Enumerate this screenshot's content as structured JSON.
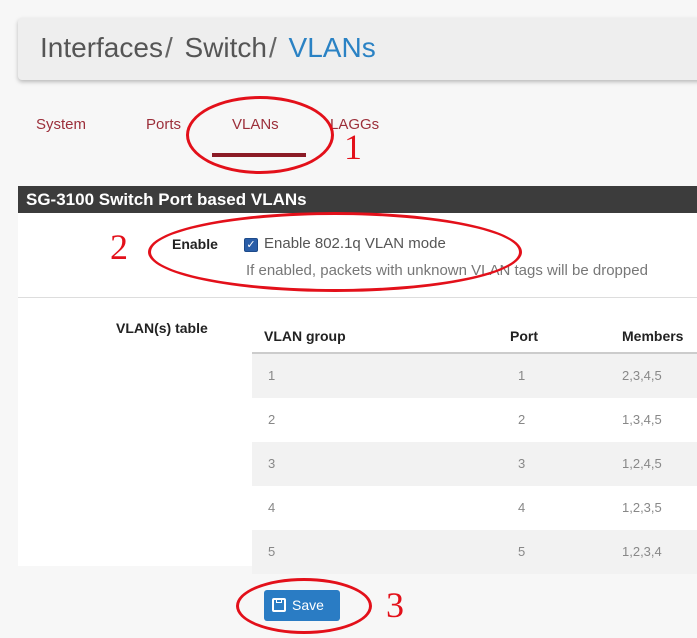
{
  "breadcrumb": {
    "items": [
      "Interfaces",
      "Switch",
      "VLANs"
    ],
    "separator": "/"
  },
  "tabs": [
    {
      "label": "System"
    },
    {
      "label": "Ports"
    },
    {
      "label": "VLANs",
      "active": true
    },
    {
      "label": "LAGGs"
    }
  ],
  "panel": {
    "title": "SG-3100 Switch Port based VLANs",
    "enable_label": "Enable",
    "enable_checkbox_label": "Enable 802.1q VLAN mode",
    "enable_checked": true,
    "enable_help": "If enabled, packets with unknown VLAN tags will be dropped",
    "vlan_table_label": "VLAN(s) table"
  },
  "vlan_table": {
    "headers": [
      "VLAN group",
      "Port",
      "Members"
    ],
    "rows": [
      [
        "1",
        "1",
        "2,3,4,5"
      ],
      [
        "2",
        "2",
        "1,3,4,5"
      ],
      [
        "3",
        "3",
        "1,2,4,5"
      ],
      [
        "4",
        "4",
        "1,2,3,5"
      ],
      [
        "5",
        "5",
        "1,2,3,4"
      ]
    ]
  },
  "actions": {
    "save_label": "Save"
  },
  "annotations": [
    "1",
    "2",
    "3"
  ],
  "colors": {
    "accent": "#2a82c4",
    "tab_text": "#9c2f3a",
    "annotation": "#e3101a",
    "panel_header": "#3c3c3c"
  }
}
